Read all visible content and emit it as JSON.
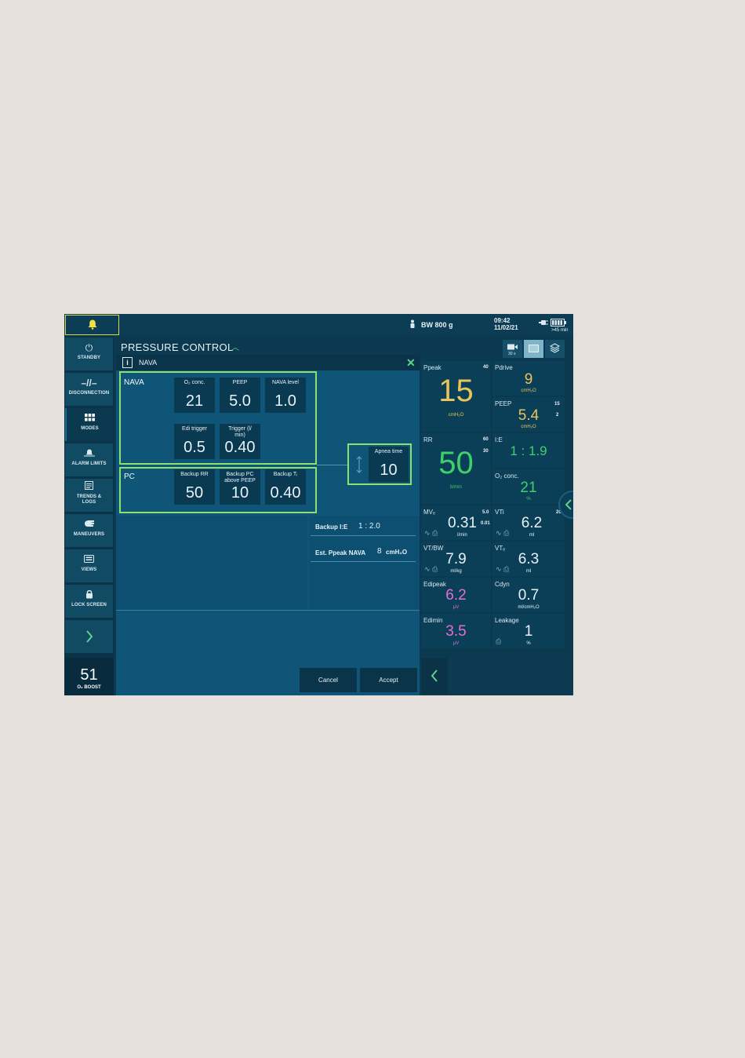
{
  "topbar": {
    "bw": "BW 800 g",
    "time": "09:42",
    "date": "11/02/21",
    "battery": ">45 min"
  },
  "sidebar": {
    "items": [
      {
        "label": "STANDBY",
        "icon": "power-icon"
      },
      {
        "label": "DISCONNECTION",
        "icon": "disconnect-icon"
      },
      {
        "label": "MODES",
        "icon": "grid-icon"
      },
      {
        "label": "ALARM LIMITS",
        "icon": "alarm-bell-icon"
      },
      {
        "label": "TRENDS & LOGS",
        "icon": "trends-icon"
      },
      {
        "label": "MANEUVERS",
        "icon": "hand-icon"
      },
      {
        "label": "VIEWS",
        "icon": "views-icon"
      },
      {
        "label": "LOCK SCREEN",
        "icon": "lock-icon"
      }
    ],
    "boost_value": "51",
    "boost_label": "O₂ BOOST"
  },
  "mode_title": "PRESSURE CONTROL",
  "view_icons": {
    "record_label": "30 s"
  },
  "dialog": {
    "title": "NAVA",
    "nava_group": "NAVA",
    "pc_group": "PC",
    "nava_settings": [
      {
        "label": "O₂ conc.",
        "value": "21"
      },
      {
        "label": "PEEP",
        "value": "5.0"
      },
      {
        "label": "NAVA level",
        "value": "1.0"
      },
      {
        "label": "Edi trigger",
        "value": "0.5"
      },
      {
        "label": "Trigger (l/ min)",
        "value": "0.40"
      }
    ],
    "pc_settings": [
      {
        "label": "Backup RR",
        "value": "50"
      },
      {
        "label": "Backup PC above PEEP",
        "value": "10"
      },
      {
        "label": "Backup Tᵢ",
        "value": "0.40"
      }
    ],
    "apnea": {
      "label": "Apnea time",
      "value": "10"
    },
    "backup_ie_label": "Backup I:E",
    "backup_ie_value": "1 : 2.0",
    "est_ppeak_label": "Est. Ppeak NAVA",
    "est_ppeak_value": "8",
    "est_ppeak_unit": "cmH₂O",
    "cancel": "Cancel",
    "accept": "Accept"
  },
  "measured": {
    "ppeak": {
      "title": "Ppeak",
      "value": "15",
      "unit": "cmH₂O",
      "limit_hi": "40"
    },
    "pdrive": {
      "title": "Pdrive",
      "value": "9",
      "unit": "cmH₂O"
    },
    "peep": {
      "title": "PEEP",
      "value": "5.4",
      "unit": "cmH₂O",
      "limit_hi": "15",
      "limit_lo": "2"
    },
    "rr": {
      "title": "RR",
      "value": "50",
      "unit": "b/min",
      "limit_hi": "60",
      "limit_lo": "30"
    },
    "ie": {
      "title": "I:E",
      "value": "1 : 1.9"
    },
    "o2": {
      "title": "O₂ conc.",
      "value": "21",
      "unit": "%"
    },
    "mve": {
      "title": "MVₑ",
      "value": "0.31",
      "unit": "l/min",
      "limit_hi": "5.0",
      "limit_lo": "0.01"
    },
    "vti": {
      "title": "VTi",
      "value": "6.2",
      "unit": "ml",
      "limit_hi": "20"
    },
    "vtbw": {
      "title": "VT/BW",
      "value": "7.9",
      "unit": "ml/kg"
    },
    "vte": {
      "title": "VTₑ",
      "value": "6.3",
      "unit": "ml"
    },
    "edipeak": {
      "title": "Edipeak",
      "value": "6.2",
      "unit": "μV"
    },
    "cdyn": {
      "title": "Cdyn",
      "value": "0.7",
      "unit": "ml/cmH₂O"
    },
    "edimin": {
      "title": "Edimin",
      "value": "3.5",
      "unit": "μV"
    },
    "leakage": {
      "title": "Leakage",
      "value": "1",
      "unit": "%"
    }
  },
  "colors": {
    "ppeak": "#e8c45a",
    "rr": "#3fd06a",
    "edi": "#e56fd4",
    "volume": "#e8f2f6",
    "group_border": "#8ee06e"
  }
}
